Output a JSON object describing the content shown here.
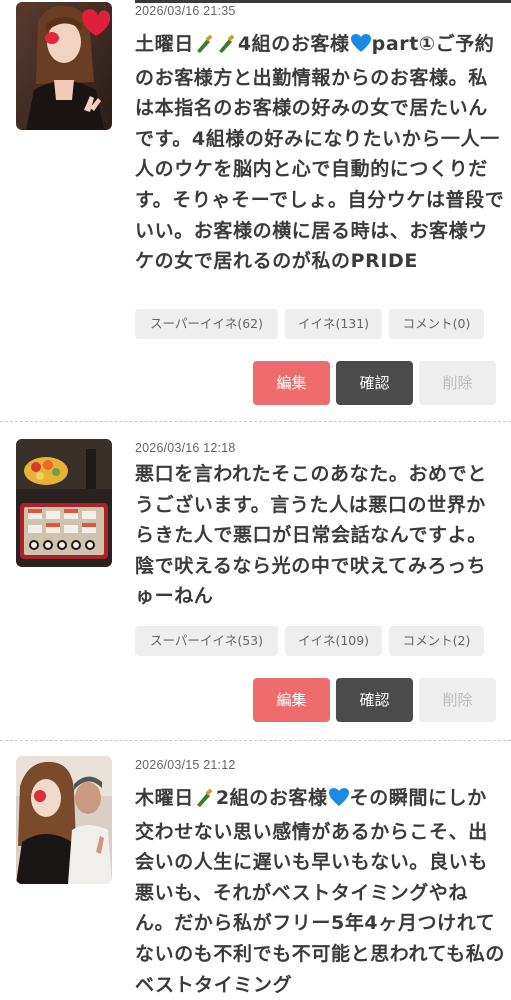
{
  "posts": [
    {
      "date": "2026/03/16 21:35",
      "body": "土曜日🍾🍾4組のお客様💙part①ご予約のお客様方と出勤情報からのお客様。私は本指名のお客様の好みの女で居たいんです。4組様の好みになりたいから一人一人のウケを脳内と心で自動的につくりだす。そりゃそーでしょ。自分ウケは普段でいい。お客様の横に居る時は、お客様ウケの女で居れるのが私のPRIDE",
      "super_like": "スーパーイイネ(62)",
      "like": "イイネ(131)",
      "comment": "コメント(0)",
      "edit_label": "編集",
      "confirm_label": "確認",
      "delete_label": "削除"
    },
    {
      "date": "2026/03/16 12:18",
      "body": "悪口を言われたそこのあなた。おめでとうございます。言うた人は悪口の世界からきた人で悪口が日常会話なんですよ。陰で吠えるなら光の中で吠えてみろっちゅーねん",
      "super_like": "スーパーイイネ(53)",
      "like": "イイネ(109)",
      "comment": "コメント(2)",
      "edit_label": "編集",
      "confirm_label": "確認",
      "delete_label": "削除"
    },
    {
      "date": "2026/03/15 21:12",
      "body": "木曜日🍾2組のお客様💙その瞬間にしか交わせない思い感情があるからこそ、出会いの人生に遅いも早いもない。良いも悪いも、それがベストタイミングやねん。だから私がフリー5年4ヶ月つけれてないのも不利でも不可能と思われても私のベストタイミング"
    }
  ],
  "colors": {
    "edit": "#ee6c6c",
    "confirm": "#4b4b4b",
    "delete": "#eeeeee",
    "stat_bg": "#eeeeee",
    "text": "#3b3b3b"
  },
  "icons": [
    "champagne-icon",
    "blue-heart-icon"
  ]
}
